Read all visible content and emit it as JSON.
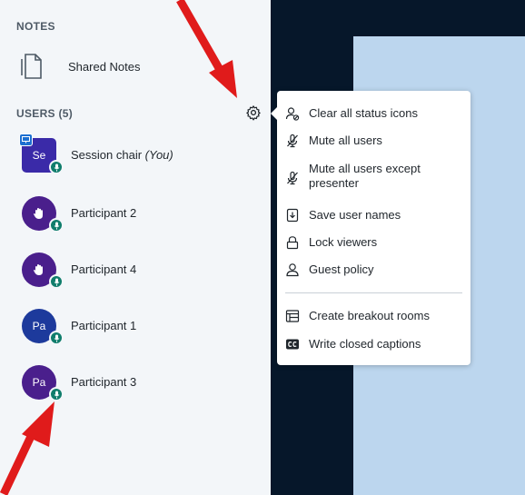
{
  "sidebar": {
    "notes_title": "NOTES",
    "shared_notes_label": "Shared Notes",
    "users_title": "USERS (5)",
    "users": [
      {
        "initials": "Se",
        "name": "Session chair",
        "suffix": "(You)",
        "color": "#3a2aa8",
        "status": "presenter"
      },
      {
        "initials": "",
        "name": "Participant 2",
        "color": "#4a1f8c",
        "status": "raise-hand"
      },
      {
        "initials": "",
        "name": "Participant 4",
        "color": "#4a1f8c",
        "status": "raise-hand"
      },
      {
        "initials": "Pa",
        "name": "Participant 1",
        "color": "#1d3a9c",
        "status": "none"
      },
      {
        "initials": "Pa",
        "name": "Participant 3",
        "color": "#4a1f8c",
        "status": "none"
      }
    ]
  },
  "menu": {
    "items": [
      {
        "label": "Clear all status icons",
        "icon": "clear-status-icon"
      },
      {
        "label": "Mute all users",
        "icon": "mic-off-icon"
      },
      {
        "label": "Mute all users except presenter",
        "icon": "mic-off-icon"
      },
      {
        "label": "Save user names",
        "icon": "download-icon"
      },
      {
        "label": "Lock viewers",
        "icon": "lock-icon"
      },
      {
        "label": "Guest policy",
        "icon": "user-icon"
      },
      {
        "label": "Create breakout rooms",
        "icon": "breakout-rooms-icon"
      },
      {
        "label": "Write closed captions",
        "icon": "closed-captions-icon"
      }
    ]
  },
  "colors": {
    "sidebar_bg": "#f3f6f9",
    "dark_bg": "#06172a",
    "slide_bg": "#bcd6ee",
    "unmuted_badge": "#0f7d6c",
    "arrow": "#e01b1b"
  }
}
